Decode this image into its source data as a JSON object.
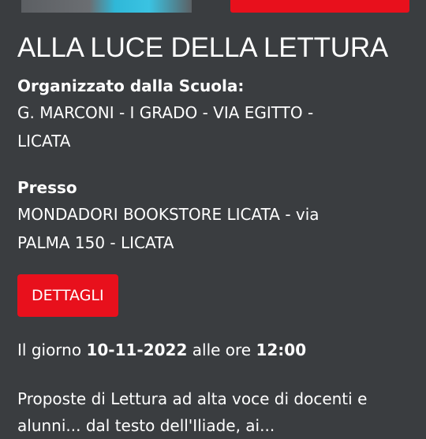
{
  "event": {
    "title": "ALLA LUCE DELLA LETTURA",
    "organizer_label": "Organizzato dalla Scuola:",
    "organizer_line1": "G. MARCONI - I GRADO - VIA EGITTO -",
    "organizer_line2": "LICATA",
    "location_label": "Presso",
    "location_line1": "MONDADORI BOOKSTORE LICATA - via",
    "location_line2": "PALMA 150 - LICATA",
    "details_button": "DETTAGLI",
    "date_prefix": "Il giorno",
    "date": "10-11-2022",
    "time_prefix": "alle ore",
    "time": "12:00",
    "description_line1": "Proposte di Lettura ad alta voce di docenti e",
    "description_line2": "alunni... dal testo dell'Iliade, ai..."
  },
  "colors": {
    "background": "#3a3d40",
    "accent": "#e8101c",
    "text": "#ffffff"
  }
}
